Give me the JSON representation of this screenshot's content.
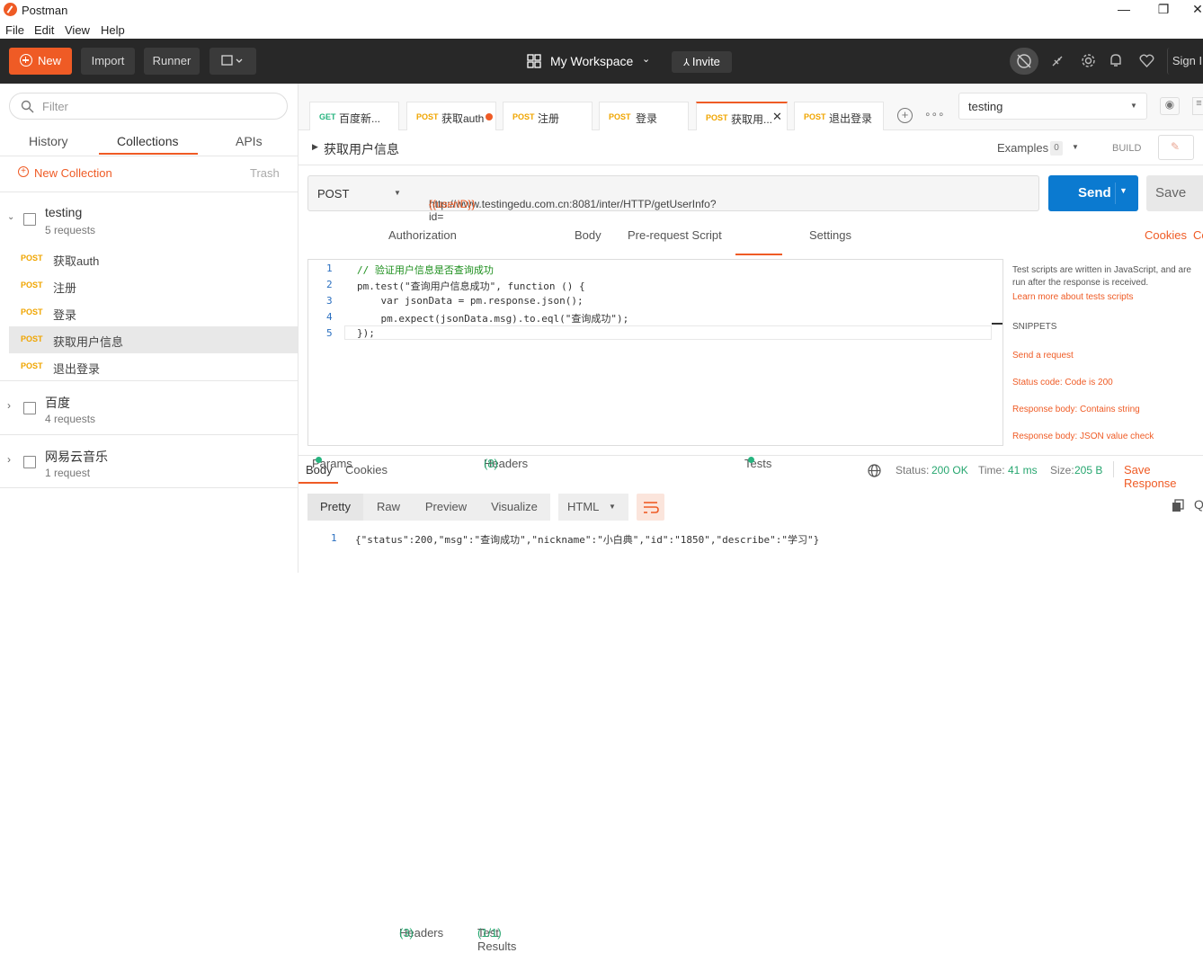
{
  "window": {
    "title": "Postman",
    "minimize": "—",
    "maximize": "❐",
    "close": "✕"
  },
  "menu": [
    "File",
    "Edit",
    "View",
    "Help"
  ],
  "header": {
    "new_label": "New",
    "import_label": "Import",
    "runner_label": "Runner",
    "workspace": "My Workspace",
    "invite_label": "Invite",
    "signin_label": "Sign I"
  },
  "sidebar": {
    "filter_placeholder": "Filter",
    "tabs": [
      "History",
      "Collections",
      "APIs"
    ],
    "new_collection": "New Collection",
    "trash": "Trash",
    "collections": [
      {
        "name": "testing",
        "count": "5 requests",
        "requests": [
          {
            "method": "POST",
            "name": "获取auth"
          },
          {
            "method": "POST",
            "name": "注册"
          },
          {
            "method": "POST",
            "name": "登录"
          },
          {
            "method": "POST",
            "name": "获取用户信息"
          },
          {
            "method": "POST",
            "name": "退出登录"
          }
        ]
      },
      {
        "name": "百度",
        "count": "4 requests"
      },
      {
        "name": "网易云音乐",
        "count": "1 request"
      }
    ]
  },
  "tabs": [
    {
      "method": "GET",
      "name": "百度新..."
    },
    {
      "method": "POST",
      "name": "获取auth"
    },
    {
      "method": "POST",
      "name": "注册"
    },
    {
      "method": "POST",
      "name": "登录"
    },
    {
      "method": "POST",
      "name": "获取用..."
    },
    {
      "method": "POST",
      "name": "退出登录"
    }
  ],
  "environment": "testing",
  "request": {
    "title": "获取用户信息",
    "examples_label": "Examples",
    "examples_count": "0",
    "build_label": "BUILD",
    "method": "POST",
    "url_base": "http://www.testingedu.com.cn:8081/inter/HTTP/getUserInfo?id=",
    "url_var": "{{userID}}",
    "send_label": "Send",
    "save_label": "Save"
  },
  "request_tabs": {
    "params": "Params",
    "authorization": "Authorization",
    "headers": "Headers",
    "headers_count": "(8)",
    "body": "Body",
    "prerequest": "Pre-request Script",
    "tests": "Tests",
    "settings": "Settings",
    "cookies": "Cookies",
    "code": "Co"
  },
  "editor": {
    "line_numbers": [
      "1",
      "2",
      "3",
      "4",
      "5"
    ],
    "lines": [
      "// 验证用户信息是否查询成功",
      "pm.test(\"查询用户信息成功\", function () {",
      "    var jsonData = pm.response.json();",
      "    pm.expect(jsonData.msg).to.eql(\"查询成功\");",
      "});"
    ]
  },
  "snippets": {
    "intro": "Test scripts are written in JavaScript, and are run after the response is received.",
    "learn_more": "Learn more about tests scripts",
    "heading": "SNIPPETS",
    "items": [
      "Send a request",
      "Status code: Code is 200",
      "Response body: Contains string",
      "Response body: JSON value check"
    ]
  },
  "response": {
    "tabs": [
      "Body",
      "Cookies",
      "Headers",
      "Test Results"
    ],
    "headers_count": "(3)",
    "tests_count": "(1/1)",
    "status_label": "Status:",
    "status_value": "200 OK",
    "time_label": "Time:",
    "time_value": "41 ms",
    "size_label": "Size:",
    "size_value": "205 B",
    "save_label": "Save Response",
    "views": [
      "Pretty",
      "Raw",
      "Preview",
      "Visualize"
    ],
    "format": "HTML",
    "line_number": "1",
    "body": "{\"status\":200,\"msg\":\"查询成功\",\"nickname\":\"小白典\",\"id\":\"1850\",\"describe\":\"学习\"}"
  },
  "colors": {
    "accent": "#ef5b25",
    "send": "#0b7ad0",
    "header_bg": "#282828",
    "post": "#f0a500",
    "success": "#26b47f"
  }
}
